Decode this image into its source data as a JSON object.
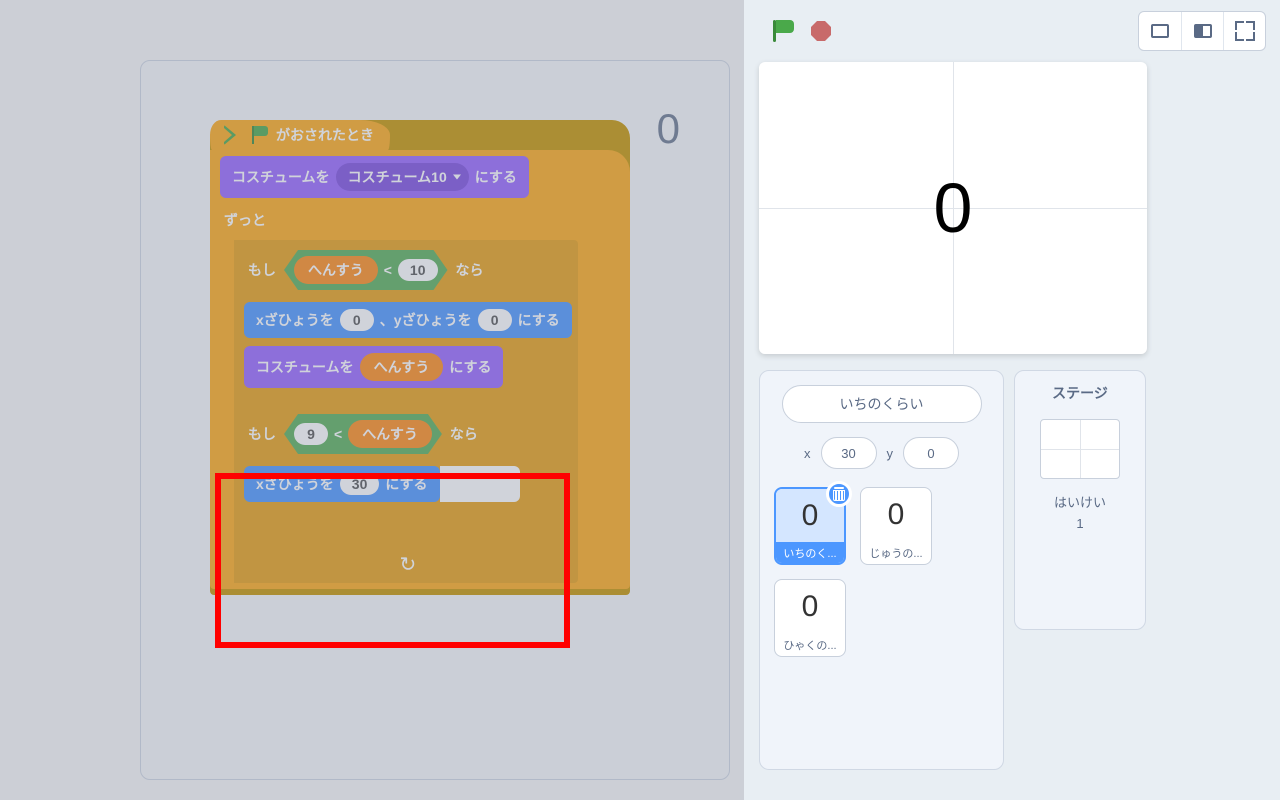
{
  "workspace": {
    "overlay_number": "0"
  },
  "blocks": {
    "hat_label": "がおされたとき",
    "set_costume_prefix": "コスチュームを",
    "set_costume_dd": "コスチューム10",
    "set_costume_suffix": "にする",
    "forever": "ずっと",
    "if_prefix": "もし",
    "if_suffix": "なら",
    "var_name": "へんすう",
    "lt": "<",
    "ten": "10",
    "goto_x_prefix": "xざひょうを",
    "goto_y_prefix": "、yざひょうを",
    "goto_suffix": "にする",
    "zero": "0",
    "set_costume_var_prefix": "コスチュームを",
    "set_costume_var_suffix": "にする",
    "nine": "9",
    "setx_prefix": "xざひょうを",
    "setx_val": "30",
    "setx_suffix": "にする"
  },
  "stage": {
    "display": "0"
  },
  "controls": {},
  "sprite": {
    "name": "いちのくらい",
    "x_label": "x",
    "x": "30",
    "y_label": "y",
    "y": "0",
    "tiles": [
      {
        "thumb": "0",
        "label": "いちのく...",
        "selected": true
      },
      {
        "thumb": "0",
        "label": "じゅうの...",
        "selected": false
      },
      {
        "thumb": "0",
        "label": "ひゃくの...",
        "selected": false
      }
    ]
  },
  "stagepanel": {
    "title": "ステージ",
    "backdrop_label": "はいけい",
    "backdrop_count": "1"
  }
}
